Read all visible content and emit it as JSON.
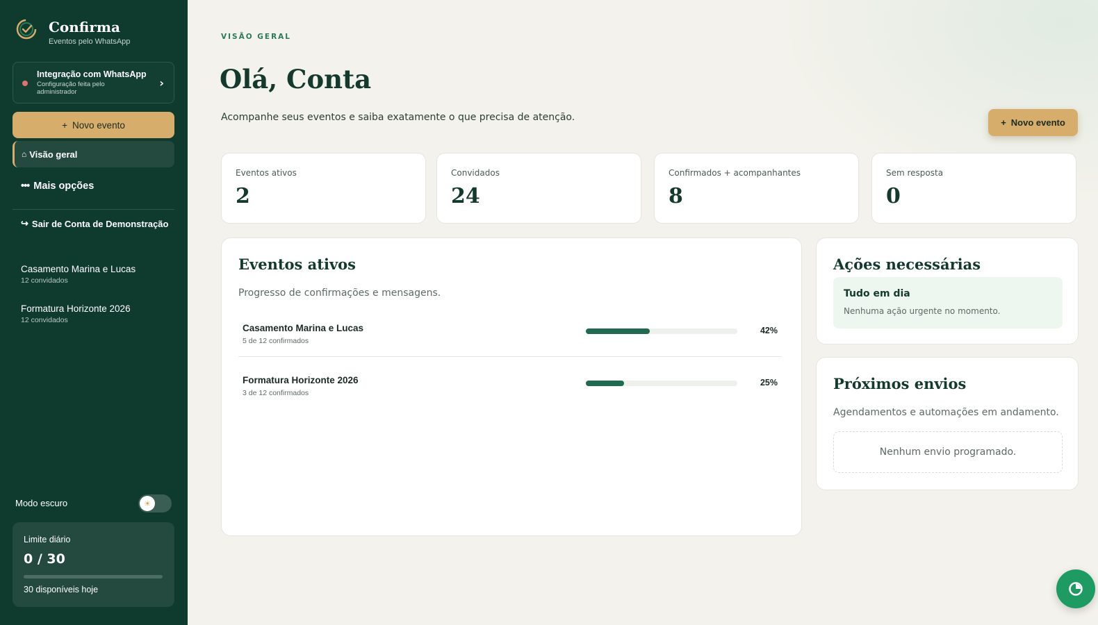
{
  "brand": {
    "name": "Confirma",
    "tagline": "Eventos pelo WhatsApp"
  },
  "sidebar": {
    "whatsapp": {
      "title": "Integração com WhatsApp",
      "subtitle": "Configuração feita pelo administrador",
      "status_color": "#e07272"
    },
    "new_event_label": "Novo evento",
    "nav_active": "Visão geral",
    "more_label": "Mais opções",
    "logout_label": "Sair de Conta de Demonstração",
    "events": [
      {
        "name": "Casamento Marina e Lucas",
        "count": "12 convidados"
      },
      {
        "name": "Formatura Horizonte 2026",
        "count": "12 convidados"
      }
    ],
    "dark_mode_label": "Modo escuro",
    "dark_mode_on": false,
    "limit": {
      "label": "Limite diário",
      "value": "0 / 30",
      "used_fraction": 0,
      "available": "30 disponíveis hoje"
    }
  },
  "main": {
    "eyebrow": "VISÃO GERAL",
    "greeting": "Olá, Conta",
    "subtitle": "Acompanhe seus eventos e saiba exatamente o que precisa de atenção.",
    "new_event_label": "Novo evento",
    "stats": [
      {
        "label": "Eventos ativos",
        "value": "2"
      },
      {
        "label": "Convidados",
        "value": "24"
      },
      {
        "label": "Confirmados + acompanhantes",
        "value": "8"
      },
      {
        "label": "Sem resposta",
        "value": "0"
      }
    ],
    "active_events": {
      "title": "Eventos ativos",
      "subtitle": "Progresso de confirmações e mensagens.",
      "items": [
        {
          "name": "Casamento Marina e Lucas",
          "confirmed": "5 de 12 confirmados",
          "percent_label": "42%",
          "progress": 0.42
        },
        {
          "name": "Formatura Horizonte 2026",
          "confirmed": "3 de 12 confirmados",
          "percent_label": "25%",
          "progress": 0.25
        }
      ]
    },
    "actions": {
      "title": "Ações necessárias",
      "status_title": "Tudo em dia",
      "status_text": "Nenhuma ação urgente no momento."
    },
    "upcoming": {
      "title": "Próximos envios",
      "subtitle": "Agendamentos e automações em andamento.",
      "empty_text": "Nenhum envio programado."
    }
  },
  "colors": {
    "sidebar_bg": "#0f3a2e",
    "accent_gold": "#d6ad6b",
    "progress_green": "#1f6a50",
    "fab_green": "#1e9a63"
  },
  "icons": {
    "brand": "check-circle-logo-icon",
    "home": "home-icon",
    "more": "dots-icon",
    "logout": "logout-arrow-icon",
    "fab": "chat-icon"
  }
}
